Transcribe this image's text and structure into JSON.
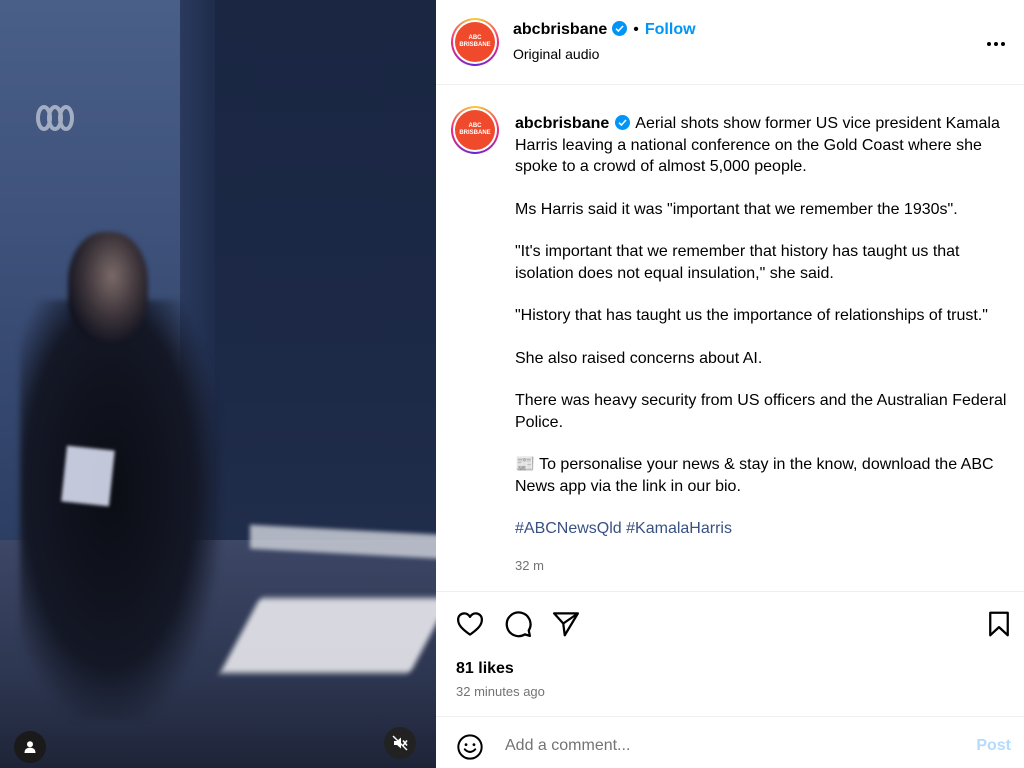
{
  "media": {
    "watermark_logo": "ABC",
    "user_tag_icon": "person-icon",
    "mute_icon": "speaker-muted-icon"
  },
  "header": {
    "username": "abcbrisbane",
    "separator": "•",
    "follow_label": "Follow",
    "audio_label": "Original audio",
    "more_label": "•••",
    "avatar_text_line1": "ABC",
    "avatar_text_line2": "BRISBANE"
  },
  "caption": {
    "username": "abcbrisbane",
    "paragraphs": [
      "Aerial shots show former US vice president Kamala Harris leaving a national conference on the Gold Coast where she spoke to a crowd of almost 5,000 people.",
      "Ms Harris said it was \"important that we remember the 1930s\".",
      "\"It's important that we remember that history has taught us that isolation does not equal insulation,\" she said.",
      "\"History that has taught us the importance of relationships of trust.\"",
      "She also raised concerns about AI.",
      "There was heavy security from US officers and the Australian Federal Police.",
      "📰 To personalise your news & stay in the know, download the ABC News app via the link in our bio."
    ],
    "hashtags": [
      "#ABCNewsQld",
      "#KamalaHarris"
    ],
    "time": "32 m"
  },
  "actions": {
    "likes": "81 likes",
    "time_ago": "32 minutes ago"
  },
  "comment": {
    "placeholder": "Add a comment...",
    "post_label": "Post"
  },
  "colors": {
    "accent": "#0095f6",
    "hashtag": "#385185",
    "post_disabled": "#b3dbff",
    "muted_text": "#737373"
  }
}
